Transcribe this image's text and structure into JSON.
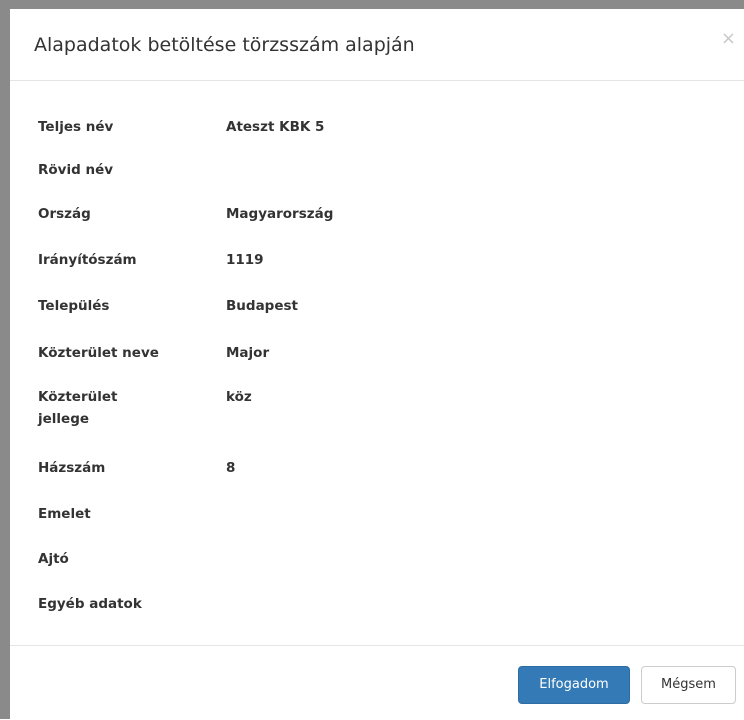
{
  "dialog": {
    "title": "Alapadatok betöltése törzsszám alapján",
    "close_label": "×"
  },
  "fields": [
    {
      "label": "Teljes név",
      "value": "Ateszt KBK 5"
    },
    {
      "label": "Rövid név",
      "value": ""
    },
    {
      "label": "Ország",
      "value": "Magyarország"
    },
    {
      "label": "Irányítószám",
      "value": "1119"
    },
    {
      "label": "Település",
      "value": "Budapest"
    },
    {
      "label": "Közterület neve",
      "value": "Major"
    },
    {
      "label": "Közterület jellege",
      "value": "köz"
    },
    {
      "label": "Házszám",
      "value": "8"
    },
    {
      "label": "Emelet",
      "value": ""
    },
    {
      "label": "Ajtó",
      "value": ""
    },
    {
      "label": "Egyéb adatok",
      "value": ""
    }
  ],
  "footer": {
    "accept_label": "Elfogadom",
    "cancel_label": "Mégsem"
  },
  "colors": {
    "primary": "#337ab7",
    "border": "#e5e5e5",
    "text": "#333333"
  }
}
